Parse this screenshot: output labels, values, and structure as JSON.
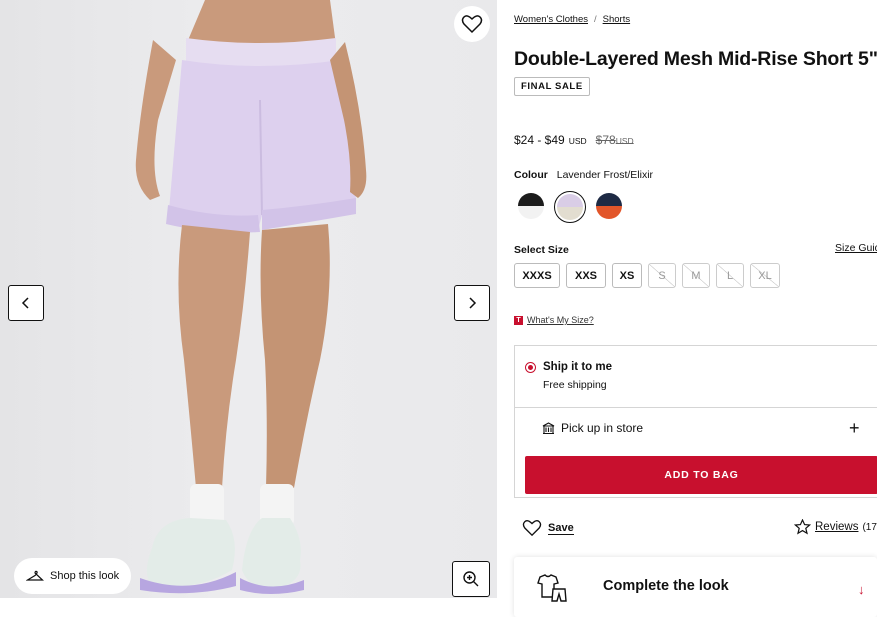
{
  "gallery": {
    "favorite_icon": "heart-outline-icon",
    "prev_icon": "chevron-left-icon",
    "next_icon": "chevron-right-icon",
    "zoom_icon": "zoom-in-icon",
    "shop_look_label": "Shop this look"
  },
  "breadcrumb": [
    "Women's Clothes",
    "Shorts"
  ],
  "product": {
    "title": "Double-Layered Mesh Mid-Rise Short 5\"",
    "badge": "FINAL SALE",
    "price_range": "$24 - $49",
    "currency": "USD",
    "original_price": "$78",
    "original_currency": "USD"
  },
  "colour": {
    "label": "Colour",
    "selected": "Lavender Frost/Elixir",
    "swatches": [
      {
        "name": "black-white",
        "top": "#1c1c1c",
        "bottom": "#f2f2f2",
        "selected": false
      },
      {
        "name": "lavender-frost",
        "top": "#d9cde6",
        "bottom": "#e2ddd0",
        "selected": true
      },
      {
        "name": "navy-orange",
        "top": "#1e2a44",
        "bottom": "#e2562a",
        "selected": false
      }
    ]
  },
  "size": {
    "label": "Select Size",
    "guide": "Size Guide",
    "options": [
      {
        "label": "XXXS",
        "available": true
      },
      {
        "label": "XXS",
        "available": true
      },
      {
        "label": "XS",
        "available": true
      },
      {
        "label": "S",
        "available": false
      },
      {
        "label": "M",
        "available": false
      },
      {
        "label": "L",
        "available": false
      },
      {
        "label": "XL",
        "available": false
      }
    ],
    "fit_link": "What's My Size?",
    "fit_badge": "T"
  },
  "fulfillment": {
    "ship_title": "Ship it to me",
    "ship_sub": "Free shipping",
    "pickup_label": "Pick up in store",
    "pickup_icon": "store-icon",
    "expand": "+",
    "add_to_bag": "ADD TO BAG"
  },
  "actions": {
    "save": "Save",
    "reviews": "Reviews",
    "reviews_count": "(17"
  },
  "complete_look": {
    "label": "Complete the look",
    "icon": "outfit-icon",
    "arrow": "↓"
  },
  "colors": {
    "accent": "#c8102e",
    "text": "#111111"
  }
}
